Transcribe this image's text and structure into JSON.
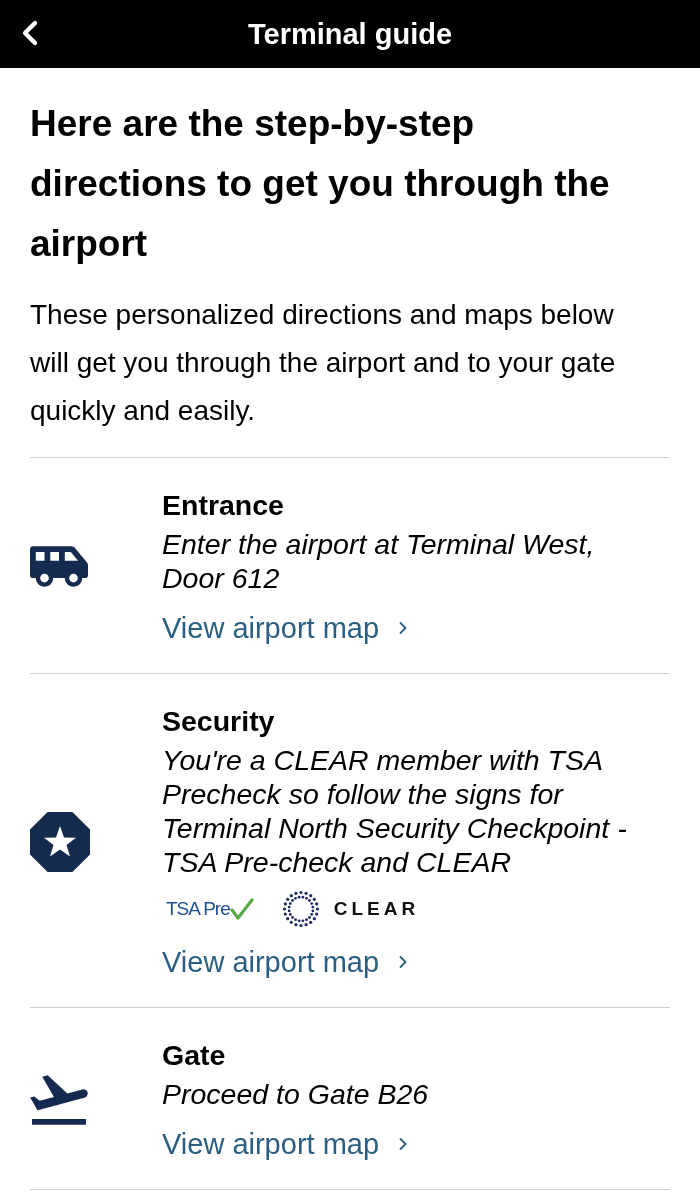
{
  "header": {
    "title": "Terminal guide"
  },
  "intro": {
    "heading": "Here are the step-by-step directions to get you through the airport",
    "body": "These personalized directions and maps below will get you through the airport and to your gate quickly and easily."
  },
  "steps": [
    {
      "kind": "van",
      "title": "Entrance",
      "description": "Enter the airport at Terminal West, Door 612",
      "link": "View airport map"
    },
    {
      "kind": "security",
      "title": "Security",
      "description": "You're a CLEAR member with TSA Precheck so follow the signs for Terminal North Security Checkpoint - TSA Pre-check and CLEAR",
      "logos": [
        {
          "kind": "tsa",
          "text": "TSA Pre"
        },
        {
          "kind": "clear",
          "text": "CLEAR"
        }
      ],
      "link": "View airport map"
    },
    {
      "kind": "plane",
      "title": "Gate",
      "description": "Proceed to Gate B26",
      "link": "View airport map"
    }
  ]
}
